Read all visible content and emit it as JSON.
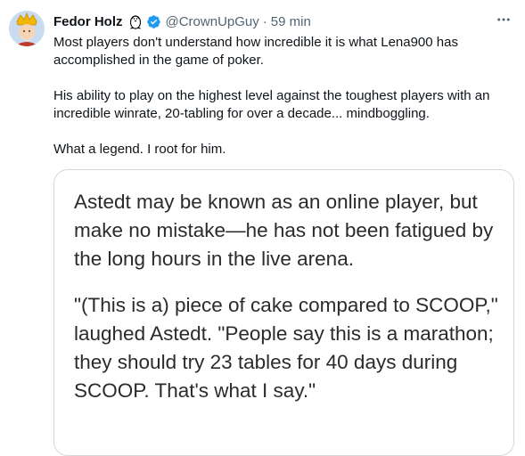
{
  "tweet": {
    "author_name": "Fedor Holz",
    "author_emoji": "penguin-icon",
    "verified": true,
    "handle": "@CrownUpGuy",
    "separator": "·",
    "time": "59 min",
    "more_icon": "more-horizontal-icon",
    "paragraphs": [
      "Most players don't understand how incredible it is what Lena900 has accomplished in the game of poker.",
      "His ability to play on the highest level against the toughest players with an incredible winrate, 20-tabling for over a decade... mindboggling.",
      "What a legend. I root for him."
    ],
    "image_text": [
      "Astedt may be known as an online player, but make no mistake—he has not been fatigued by the long hours in the live arena.",
      "\"(This is a) piece of cake compared to SCOOP,\" laughed Astedt. \"People say this is a marathon; they should try 23 tables for 40 days during SCOOP. That's what I say.\""
    ]
  },
  "colors": {
    "text_primary": "#0f1419",
    "text_secondary": "#536471",
    "verified_blue": "#1d9bf0",
    "border": "#cfd9de"
  }
}
